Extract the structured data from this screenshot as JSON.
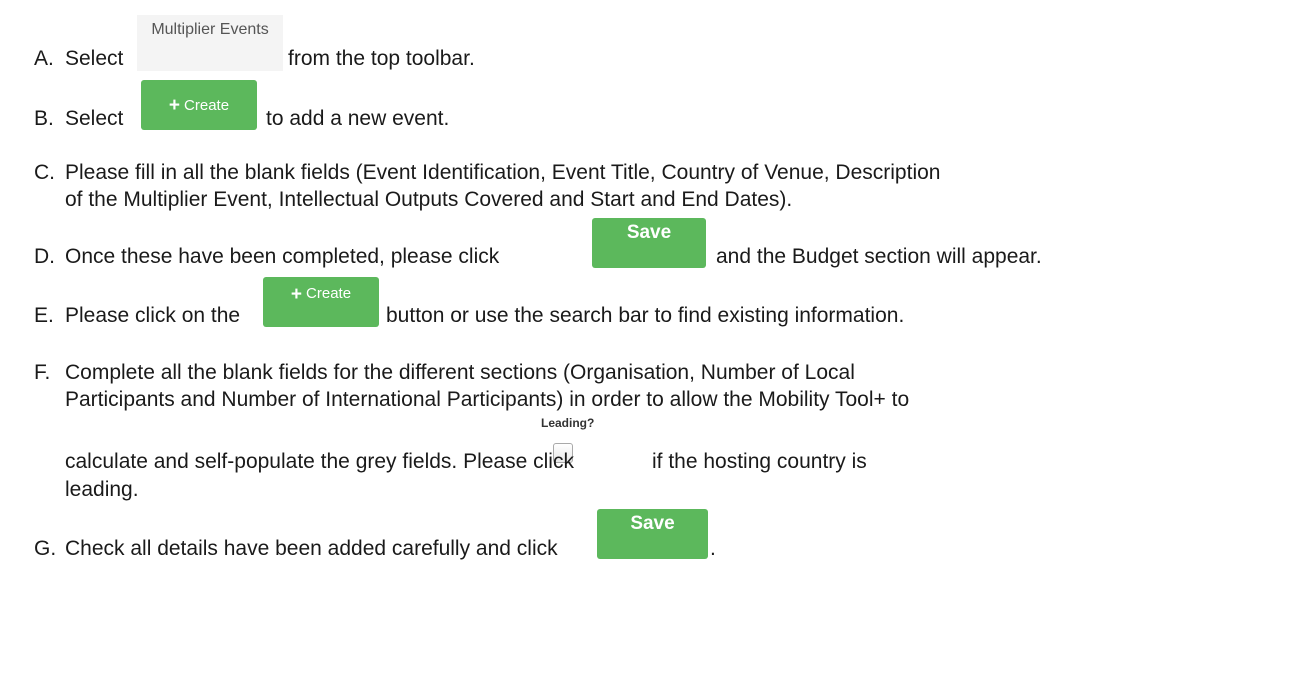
{
  "images": {
    "toolbar_tab": "Multiplier Events",
    "create_button": "Create",
    "create_icon": "plus-icon",
    "save_button": "Save",
    "leading_label": "Leading?"
  },
  "steps": {
    "a": {
      "marker": "A.",
      "before": "Select",
      "after": "from the top toolbar."
    },
    "b": {
      "marker": "B.",
      "before": "Select",
      "after": "to add a new event."
    },
    "c": {
      "marker": "C.",
      "line1": "Please fill in all the blank fields (Event Identification, Event Title, Country of Venue, Description",
      "line2": "of the Multiplier Event, Intellectual Outputs Covered and Start and End Dates)."
    },
    "d": {
      "marker": "D.",
      "before": "Once these have been completed, please click",
      "after": "and the Budget section will appear."
    },
    "e": {
      "marker": "E.",
      "before": "Please click on the",
      "after": "button or use the search bar to find existing information."
    },
    "f": {
      "marker": "F.",
      "line1": "Complete all the blank fields for the different sections (Organisation, Number of Local",
      "line2": "Participants and Number of International Participants) in order to allow the Mobility Tool+ to",
      "line3_before": "calculate and self-populate the grey fields.  Please click",
      "line3_after": "if the hosting country is",
      "line4": "leading."
    },
    "g": {
      "marker": "G.",
      "before": "Check all details have been added carefully and click",
      "after": "."
    }
  }
}
